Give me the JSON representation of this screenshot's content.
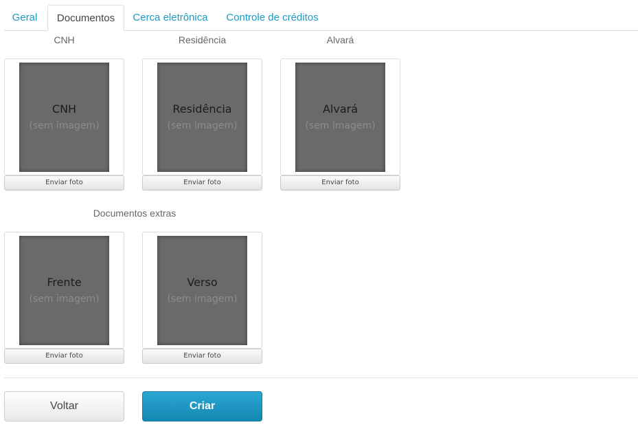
{
  "tabs": [
    {
      "label": "Geral",
      "active": false
    },
    {
      "label": "Documentos",
      "active": true
    },
    {
      "label": "Cerca eletrônica",
      "active": false
    },
    {
      "label": "Controle de créditos",
      "active": false
    }
  ],
  "documents": [
    {
      "label": "CNH",
      "title": "CNH",
      "subtitle": "(sem imagem)",
      "button": "Enviar foto"
    },
    {
      "label": "Residência",
      "title": "Residência",
      "subtitle": "(sem imagem)",
      "button": "Enviar foto"
    },
    {
      "label": "Alvará",
      "title": "Alvará",
      "subtitle": "(sem imagem)",
      "button": "Enviar foto"
    }
  ],
  "extras": {
    "label": "Documentos extras",
    "items": [
      {
        "title": "Frente",
        "subtitle": "(sem imagem)",
        "button": "Enviar foto"
      },
      {
        "title": "Verso",
        "subtitle": "(sem imagem)",
        "button": "Enviar foto"
      }
    ]
  },
  "actions": {
    "back_label": "Voltar",
    "create_label": "Criar"
  },
  "colors": {
    "accent": "#1a9ac4",
    "primary_button": "#1a96c1",
    "placeholder_bg": "#6a6a6a"
  }
}
